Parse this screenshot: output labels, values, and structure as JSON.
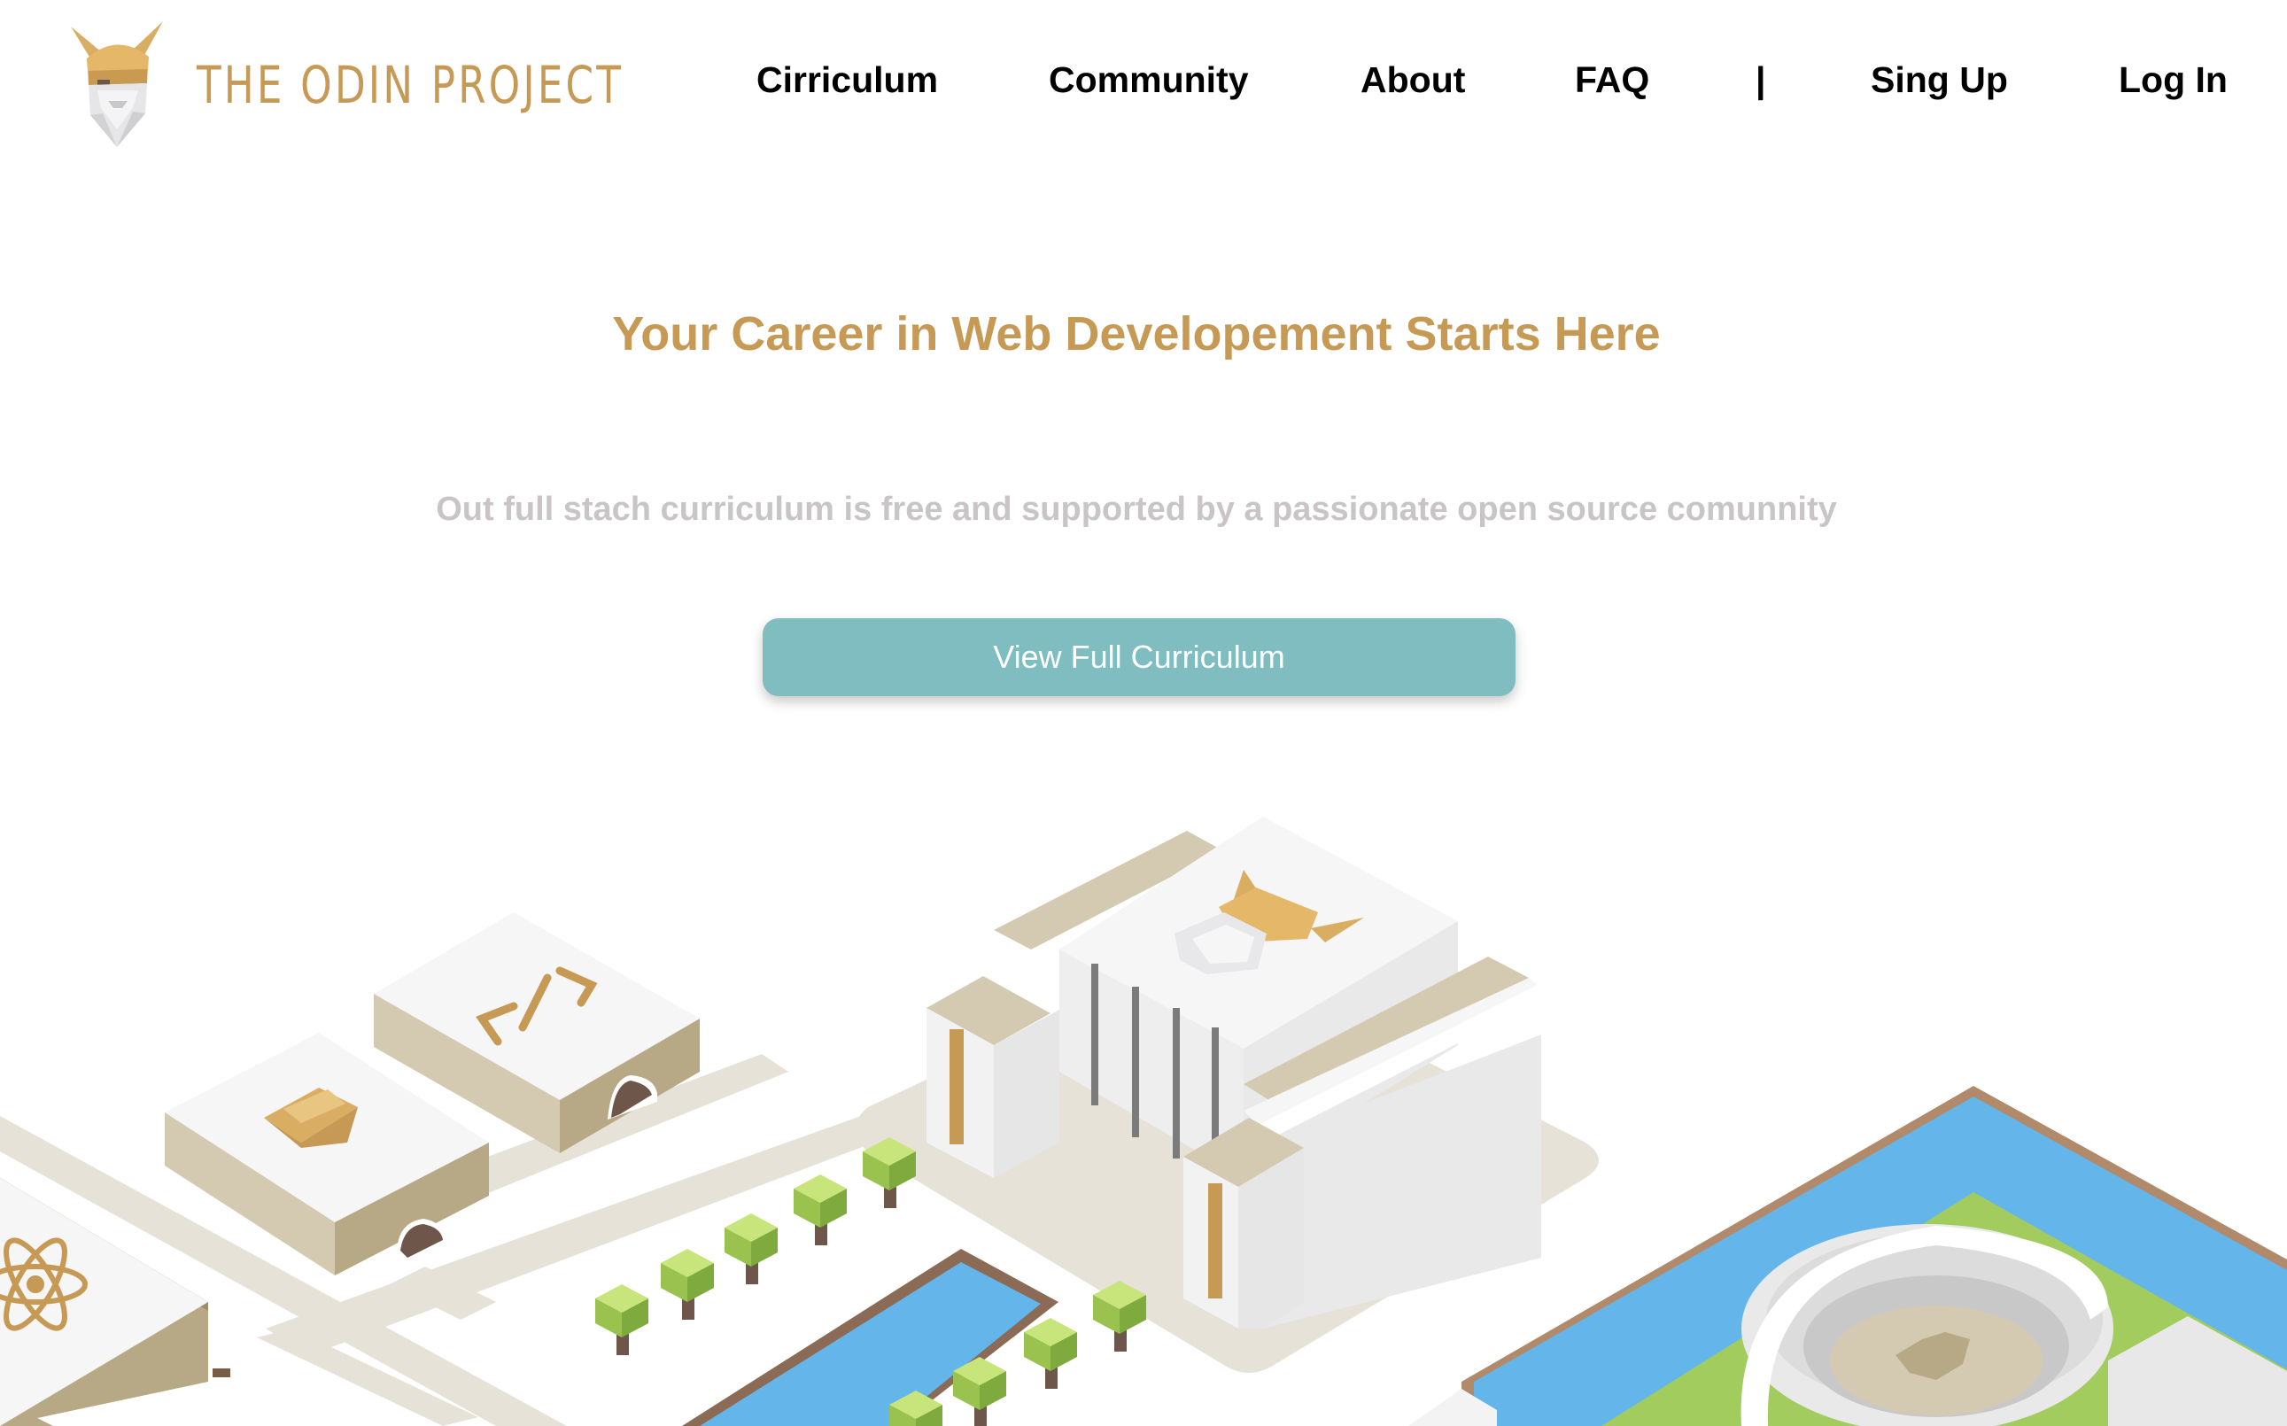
{
  "header": {
    "logo_text": "THE ODIN PROJECT",
    "nav": [
      {
        "id": "curriculum",
        "label": "Cirriculum"
      },
      {
        "id": "community",
        "label": "Community"
      },
      {
        "id": "about",
        "label": "About"
      },
      {
        "id": "faq",
        "label": "FAQ"
      },
      {
        "id": "separator",
        "label": "|"
      },
      {
        "id": "signup",
        "label": "Sing Up"
      },
      {
        "id": "login",
        "label": "Log In"
      }
    ]
  },
  "hero": {
    "title": "Your Career in Web Developement Starts Here",
    "subtitle": "Out full stach curriculum is free and supported by a passionate open source comunnity",
    "cta_label": "View Full Curriculum"
  },
  "illustration": {
    "icons": [
      "viking-helmet-logo-icon",
      "code-brackets-icon",
      "ruby-gem-icon",
      "react-atom-icon",
      "tree-icon",
      "colosseum-icon"
    ]
  },
  "colors": {
    "brand_gold": "#c69a55",
    "subtitle_gray": "#c9c5c6",
    "button_teal": "#7fbdc1",
    "water_blue": "#63b5ea",
    "grass_green": "#a2cc5e",
    "sand": "#d4cab1",
    "path": "#e6e2d8"
  }
}
